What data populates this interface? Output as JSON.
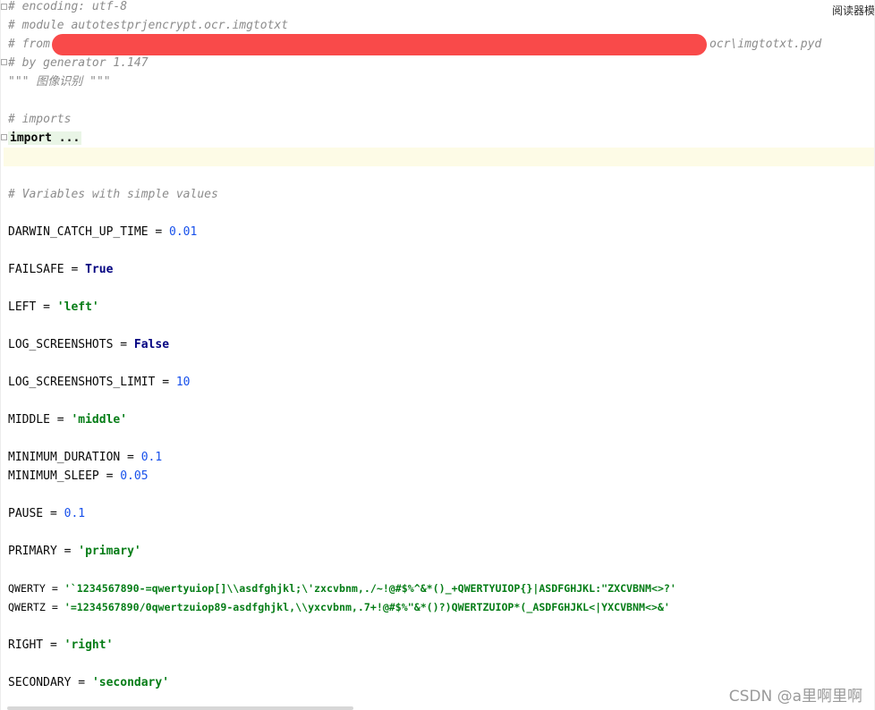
{
  "reader_mode_label": "阅读器模",
  "watermark": "CSDN @a里啊里啊",
  "lines": {
    "encoding": "# encoding: utf-8",
    "module": "# module autotestprjencrypt.ocr.imgtotxt",
    "from_prefix": "# from",
    "from_suffix": "ocr\\imgtotxt.pyd",
    "generator": "# by generator 1.147",
    "docstring": "\"\"\" 图像识别 \"\"\"",
    "imports_comment": "# imports",
    "import_folded": "import ...",
    "variables_comment": "# Variables with simple values"
  },
  "variables": [
    {
      "name": "DARWIN_CATCH_UP_TIME",
      "value": "0.01",
      "kind": "num"
    },
    {
      "name": "FAILSAFE",
      "value": "True",
      "kind": "kw"
    },
    {
      "name": "LEFT",
      "value": "'left'",
      "kind": "str"
    },
    {
      "name": "LOG_SCREENSHOTS",
      "value": "False",
      "kind": "kw"
    },
    {
      "name": "LOG_SCREENSHOTS_LIMIT",
      "value": "10",
      "kind": "num"
    },
    {
      "name": "MIDDLE",
      "value": "'middle'",
      "kind": "str"
    },
    {
      "name": "MINIMUM_DURATION",
      "value": "0.1",
      "kind": "num"
    },
    {
      "name": "MINIMUM_SLEEP",
      "value": "0.05",
      "kind": "num"
    },
    {
      "name": "PAUSE",
      "value": "0.1",
      "kind": "num"
    },
    {
      "name": "PRIMARY",
      "value": "'primary'",
      "kind": "str"
    },
    {
      "name": "QWERTY",
      "value": "'`1234567890-=qwertyuiop[]\\\\asdfghjkl;\\'zxcvbnm,./~!@#$%^&*()_+QWERTYUIOP{}|ASDFGHJKL:\"ZXCVBNM<>?'",
      "kind": "str"
    },
    {
      "name": "QWERTZ",
      "value": "'=1234567890/0qwertzuiop89-asdfghjkl,\\\\yxcvbnm,.7+!@#$%\"&*()?)QWERTZUIOP*(_ASDFGHJKL<|YXCVBNM<>&'",
      "kind": "str"
    },
    {
      "name": "RIGHT",
      "value": "'right'",
      "kind": "str"
    },
    {
      "name": "SECONDARY",
      "value": "'secondary'",
      "kind": "str"
    }
  ],
  "colors": {
    "comment": "#8c8c8c",
    "number": "#1750eb",
    "keyword": "#000080",
    "string": "#067d17",
    "redaction": "#f94a4a",
    "current_line": "#fdfbe6"
  }
}
